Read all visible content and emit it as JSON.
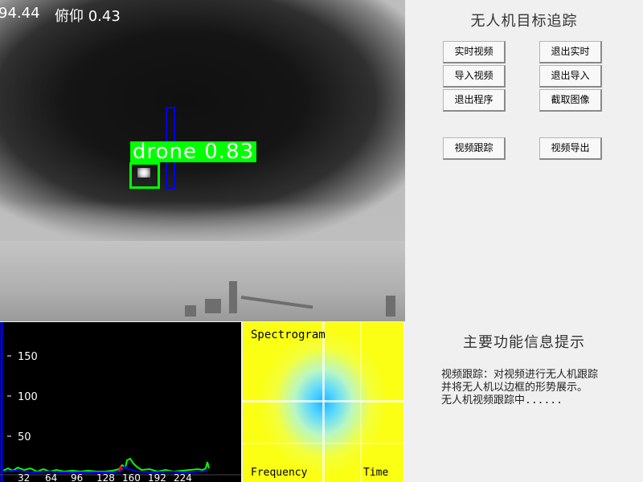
{
  "video": {
    "yaw_text": "94.44",
    "pitch_text": "俯仰 0.43",
    "detection_label": "drone 0.83"
  },
  "histogram": {
    "y_ticks": [
      "150",
      "100",
      "50"
    ],
    "x_ticks": [
      "32",
      "64",
      "96",
      "128",
      "160",
      "192",
      "224"
    ]
  },
  "spectrogram": {
    "title": "Spectrogram",
    "x_label": "Frequency",
    "time_label": "Time"
  },
  "panel": {
    "title": "无人机目标追踪",
    "buttons": {
      "realtime_video": "实时视频",
      "exit_realtime": "退出实时",
      "import_video": "导入视频",
      "exit_import": "退出导入",
      "exit_program": "退出程序",
      "capture_image": "截取图像",
      "video_tracking": "视频跟踪",
      "video_export": "视频导出"
    },
    "info_title": "主要功能信息提示",
    "info_lines": [
      "视频跟踪：对视频进行无人机跟踪",
      "并将无人机以边框的形势展示。",
      "无人机视频跟踪中......"
    ]
  },
  "colors": {
    "detection_green": "#00ff00",
    "tracker_blue": "#0000ff",
    "hist_blue": "#0000ff",
    "hist_green": "#00ff00",
    "hist_red": "#ff0000",
    "spectrogram_yellow": "#fbff14",
    "spectrogram_cyan": "#1fb3ff"
  }
}
